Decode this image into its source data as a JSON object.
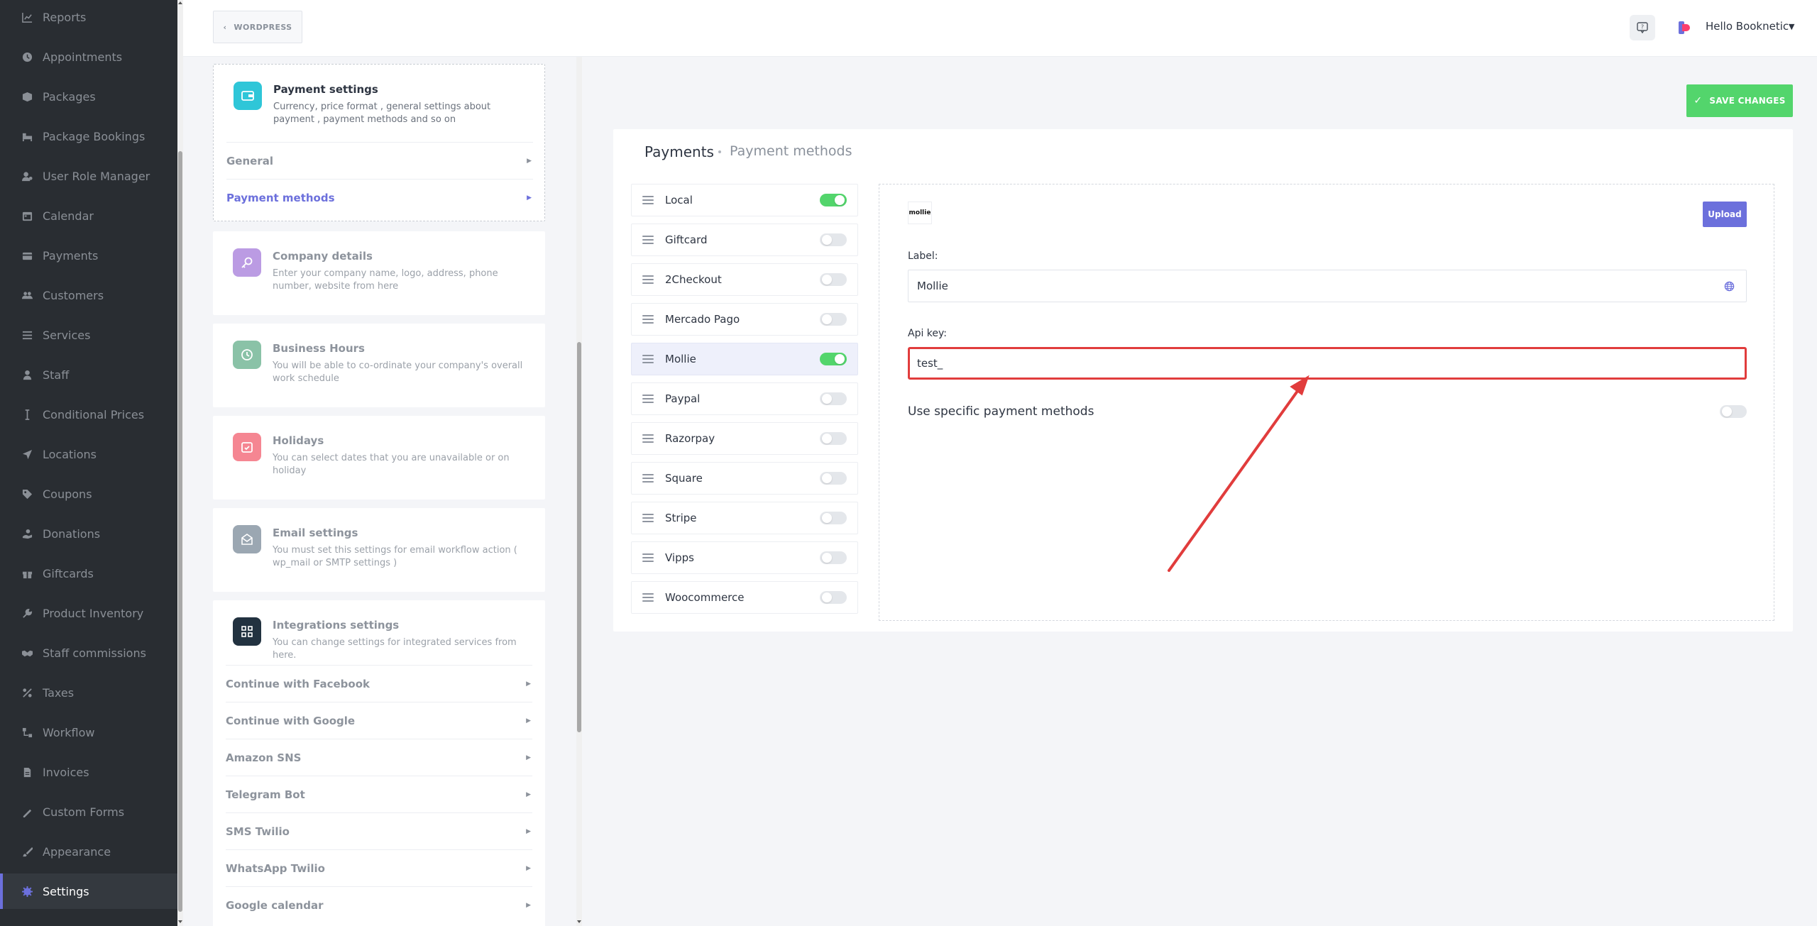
{
  "sidebar": {
    "items": [
      {
        "label": "Reports",
        "icon": "chart-icon"
      },
      {
        "label": "Appointments",
        "icon": "clock-icon"
      },
      {
        "label": "Packages",
        "icon": "box-icon"
      },
      {
        "label": "Package Bookings",
        "icon": "bed-icon"
      },
      {
        "label": "User Role Manager",
        "icon": "user-cog-icon"
      },
      {
        "label": "Calendar",
        "icon": "calendar-icon"
      },
      {
        "label": "Payments",
        "icon": "credit-card-icon"
      },
      {
        "label": "Customers",
        "icon": "users-icon"
      },
      {
        "label": "Services",
        "icon": "list-icon"
      },
      {
        "label": "Staff",
        "icon": "person-icon"
      },
      {
        "label": "Conditional Prices",
        "icon": "cursor-icon"
      },
      {
        "label": "Locations",
        "icon": "location-arrow-icon"
      },
      {
        "label": "Coupons",
        "icon": "tag-icon"
      },
      {
        "label": "Donations",
        "icon": "hand-heart-icon"
      },
      {
        "label": "Giftcards",
        "icon": "gift-icon"
      },
      {
        "label": "Product Inventory",
        "icon": "wrench-icon"
      },
      {
        "label": "Staff commissions",
        "icon": "handshake-icon"
      },
      {
        "label": "Taxes",
        "icon": "percent-icon"
      },
      {
        "label": "Workflow",
        "icon": "workflow-icon"
      },
      {
        "label": "Invoices",
        "icon": "file-icon"
      },
      {
        "label": "Custom Forms",
        "icon": "form-icon"
      },
      {
        "label": "Appearance",
        "icon": "brush-icon"
      },
      {
        "label": "Settings",
        "icon": "gear-icon"
      }
    ],
    "active": "Settings"
  },
  "header": {
    "back_label": "WORDPRESS",
    "user_greeting": "Hello Booknetic"
  },
  "settings": {
    "payment": {
      "title": "Payment settings",
      "desc": "Currency, price format , general settings about payment , payment methods and so on",
      "sub": [
        "General",
        "Payment methods"
      ]
    },
    "company": {
      "title": "Company details",
      "desc": "Enter your company name, logo, address, phone number, website from here"
    },
    "hours": {
      "title": "Business Hours",
      "desc": "You will be able to co-ordinate your company's overall work schedule"
    },
    "holidays": {
      "title": "Holidays",
      "desc": "You can select dates that you are unavailable or on holiday"
    },
    "email": {
      "title": "Email settings",
      "desc": "You must set this settings for email workflow action ( wp_mail or SMTP settings )"
    },
    "integrations": {
      "title": "Integrations settings",
      "desc": "You can change settings for integrated services from here.",
      "sub": [
        "Continue with Facebook",
        "Continue with Google",
        "Amazon SNS",
        "Telegram Bot",
        "SMS Twilio",
        "WhatsApp Twilio",
        "Google calendar"
      ]
    }
  },
  "save_label": "SAVE CHANGES",
  "panel": {
    "title": "Payments",
    "subtitle": "Payment methods",
    "methods": [
      {
        "name": "Local",
        "enabled": true
      },
      {
        "name": "Giftcard",
        "enabled": false
      },
      {
        "name": "2Checkout",
        "enabled": false
      },
      {
        "name": "Mercado Pago",
        "enabled": false
      },
      {
        "name": "Mollie",
        "enabled": true,
        "selected": true
      },
      {
        "name": "Paypal",
        "enabled": false
      },
      {
        "name": "Razorpay",
        "enabled": false
      },
      {
        "name": "Square",
        "enabled": false
      },
      {
        "name": "Stripe",
        "enabled": false
      },
      {
        "name": "Vipps",
        "enabled": false
      },
      {
        "name": "Woocommerce",
        "enabled": false
      }
    ]
  },
  "detail": {
    "logo_text": "mollie",
    "upload_label": "Upload",
    "label_label": "Label:",
    "label_value": "Mollie",
    "api_label": "Api key:",
    "api_value": "test_",
    "specific_label": "Use specific payment methods",
    "specific_enabled": false
  },
  "colors": {
    "accent": "#6c70dc",
    "success": "#53d56c",
    "sidebar_bg": "#292d32",
    "highlight": "#e13c3c"
  }
}
